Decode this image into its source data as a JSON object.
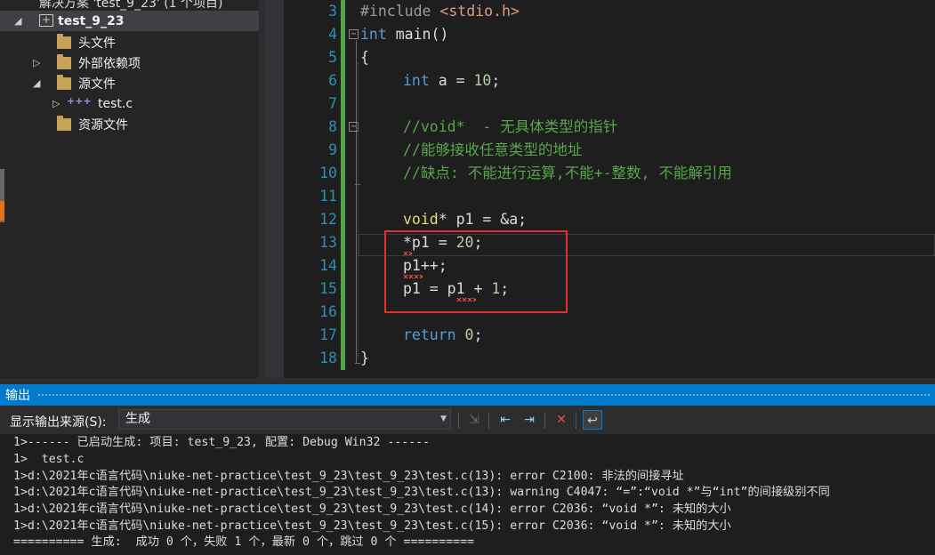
{
  "explorer": {
    "solution_label": "解决方案 'test_9_23' (1 个项目)",
    "project_label": "test_9_23",
    "items": [
      {
        "label": "头文件",
        "icon": "folder-icon"
      },
      {
        "label": "外部依赖项",
        "icon": "folder-icon"
      },
      {
        "label": "源文件",
        "icon": "folder-icon"
      },
      {
        "label": "test.c",
        "icon": "c-file-icon"
      },
      {
        "label": "资源文件",
        "icon": "folder-icon"
      }
    ]
  },
  "editor": {
    "lines": [
      {
        "n": "3"
      },
      {
        "n": "4"
      },
      {
        "n": "5"
      },
      {
        "n": "6"
      },
      {
        "n": "7"
      },
      {
        "n": "8"
      },
      {
        "n": "9"
      },
      {
        "n": "10"
      },
      {
        "n": "11"
      },
      {
        "n": "12"
      },
      {
        "n": "13"
      },
      {
        "n": "14"
      },
      {
        "n": "15"
      },
      {
        "n": "16"
      },
      {
        "n": "17"
      },
      {
        "n": "18"
      }
    ],
    "code": {
      "l3_directive": "#include",
      "l3_header": "<stdio.h>",
      "l4_type": "int",
      "l4_name": "main()",
      "l5": "{",
      "l6_type": "int",
      "l6_rest": " a = ",
      "l6_num": "10",
      "l6_end": ";",
      "l8": "//void*  - 无具体类型的指针",
      "l9": "//能够接收任意类型的地址",
      "l10": "//缺点: 不能进行运算,不能+-整数, 不能解引用",
      "l12_type": "void",
      "l12_rest": "* p1 = &a;",
      "l13_a": "*p1 = ",
      "l13_num": "20",
      "l13_end": ";",
      "l14": "p1++;",
      "l15_a": "p1 = p1 + ",
      "l15_num": "1",
      "l15_end": ";",
      "l17_kw": "return",
      "l17_sp": " ",
      "l17_num": "0",
      "l17_end": ";",
      "l18": "}"
    }
  },
  "output": {
    "title": "输出",
    "source_label": "显示输出来源(S):",
    "source_value": "生成",
    "lines": [
      "1>------ 已启动生成: 项目: test_9_23, 配置: Debug Win32 ------",
      "1>  test.c",
      "1>d:\\2021年c语言代码\\niuke-net-practice\\test_9_23\\test_9_23\\test.c(13): error C2100: 非法的间接寻址",
      "1>d:\\2021年c语言代码\\niuke-net-practice\\test_9_23\\test_9_23\\test.c(13): warning C4047: “=”:“void *”与“int”的间接级别不同",
      "1>d:\\2021年c语言代码\\niuke-net-practice\\test_9_23\\test_9_23\\test.c(14): error C2036: “void *”: 未知的大小",
      "1>d:\\2021年c语言代码\\niuke-net-practice\\test_9_23\\test_9_23\\test.c(15): error C2036: “void *”: 未知的大小",
      "========== 生成:  成功 0 个，失败 1 个，最新 0 个，跳过 0 个 =========="
    ]
  },
  "colors": {
    "accent": "#007acc",
    "change_bar": "#57a64a",
    "comment": "#57a64a",
    "keyword": "#569cd6",
    "error_box": "#e03030"
  }
}
